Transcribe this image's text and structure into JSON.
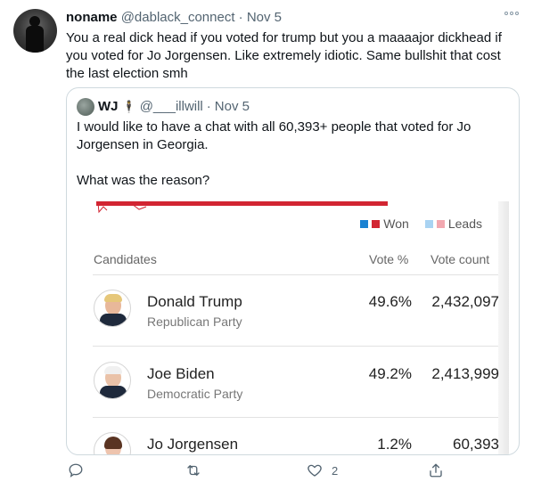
{
  "tweet": {
    "author_name": "noname",
    "author_handle": "@dablack_connect",
    "separator": "·",
    "date": "Nov 5",
    "text": "You a real dick head if you voted for trump but you a maaaajor dickhead if you voted for Jo Jorgensen. Like extremely idiotic. Same bullshit that cost the last election smh",
    "avatar_icon": "person-silhouette-avatar",
    "more_icon": "more-options-icon"
  },
  "quoted": {
    "author_name": "WJ",
    "emoji": "🕴",
    "author_handle": "@___illwill",
    "separator": "·",
    "date": "Nov 5",
    "text_line1": "I would like to have a chat with all 60,393+ people that voted for Jo Jorgensen in Georgia.",
    "text_line2": "What was the reason?",
    "media": {
      "legend_won": "Won",
      "legend_leads": "Leads",
      "colors": {
        "won_blue": "#1a82d2",
        "won_red": "#d22532",
        "leads_blue": "#a9d3f2",
        "leads_red": "#f2a8b0"
      },
      "headers": {
        "candidates": "Candidates",
        "vote_pct": "Vote %",
        "vote_count": "Vote count"
      },
      "rows": [
        {
          "name": "Donald Trump",
          "party": "Republican Party",
          "pct": "49.6%",
          "count": "2,432,097"
        },
        {
          "name": "Joe Biden",
          "party": "Democratic Party",
          "pct": "49.2%",
          "count": "2,413,999"
        },
        {
          "name": "Jo Jorgensen",
          "party": "",
          "pct": "1.2%",
          "count": "60,393"
        }
      ]
    }
  },
  "actions": {
    "reply_icon": "reply-icon",
    "retweet_icon": "retweet-icon",
    "like_icon": "heart-icon",
    "like_count": "2",
    "share_icon": "share-icon"
  }
}
